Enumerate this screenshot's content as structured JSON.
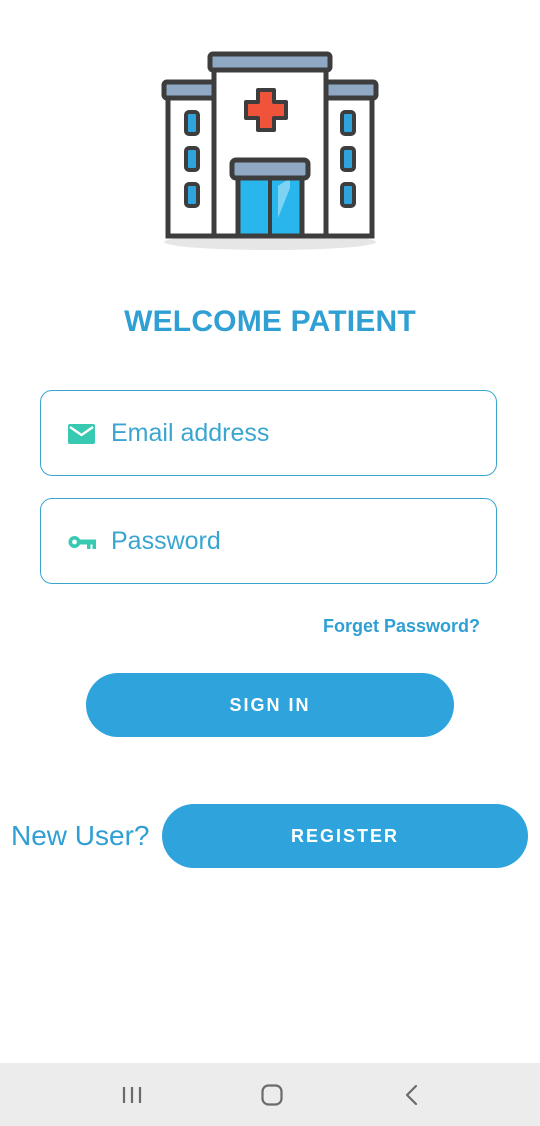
{
  "header": {
    "title": "WELCOME PATIENT",
    "logo_icon": "hospital-building-icon"
  },
  "form": {
    "email": {
      "placeholder": "Email address",
      "icon": "mail-icon"
    },
    "password": {
      "placeholder": "Password",
      "icon": "key-icon"
    },
    "forget_label": "Forget Password?",
    "signin_label": "SIGN IN"
  },
  "register": {
    "prompt": "New User?",
    "button_label": "REGISTER"
  },
  "system_nav": {
    "recent": "recent-apps-icon",
    "home": "home-icon",
    "back": "back-icon"
  },
  "colors": {
    "accent": "#2fa4dc",
    "title": "#2f9fd4",
    "field_border": "#3aa6d0",
    "icon_teal": "#38c9b2",
    "cross_red": "#f0533a",
    "navbar_bg": "#ececec"
  }
}
